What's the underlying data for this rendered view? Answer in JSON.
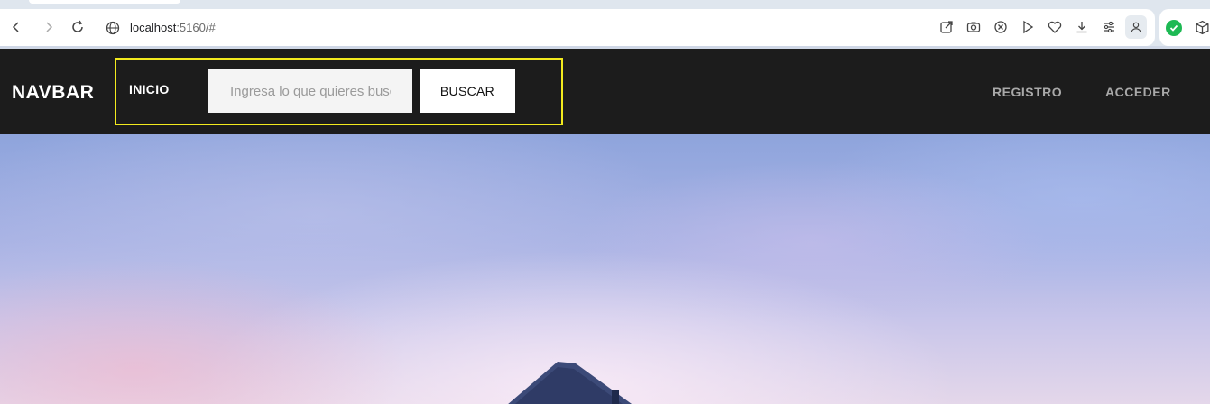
{
  "browser": {
    "url_host": "localhost",
    "url_rest": ":5160/#",
    "icons": [
      "back-icon",
      "forward-icon",
      "reload-icon",
      "site-info-icon",
      "share-icon",
      "camera-icon",
      "shield-icon",
      "play-icon",
      "heart-icon",
      "download-icon",
      "menu-lines-icon",
      "profile-icon",
      "extension-check-icon",
      "extension-box-icon"
    ]
  },
  "navbar": {
    "brand": "NAVBAR",
    "home_link": "INICIO",
    "search_placeholder": "Ingresa lo que quieres buscar",
    "search_button": "BUSCAR",
    "register_link": "REGISTRO",
    "login_link": "ACCEDER"
  },
  "colors": {
    "navbar_bg": "#1c1c1c",
    "highlight": "#f2ea1e",
    "right_links": "#a9a9a9"
  }
}
